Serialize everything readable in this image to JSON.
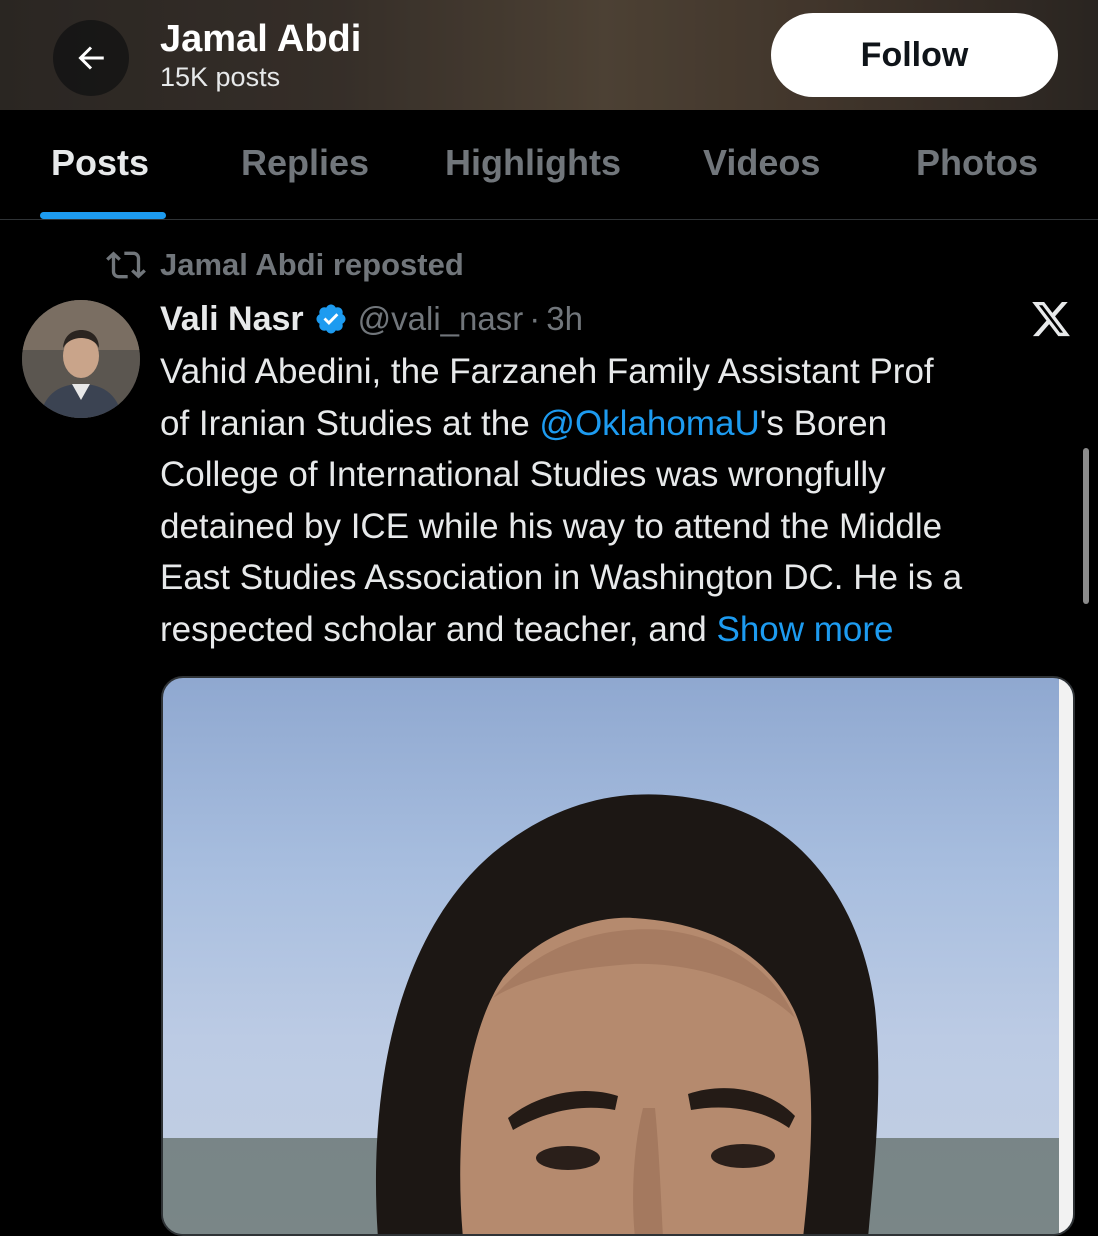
{
  "header": {
    "name": "Jamal Abdi",
    "post_count": "15K posts",
    "follow_label": "Follow"
  },
  "tabs": [
    {
      "label": "Posts",
      "active": true
    },
    {
      "label": "Replies",
      "active": false
    },
    {
      "label": "Highlights",
      "active": false
    },
    {
      "label": "Videos",
      "active": false
    },
    {
      "label": "Photos",
      "active": false
    }
  ],
  "post": {
    "repost_text": "Jamal Abdi reposted",
    "author_name": "Vali Nasr",
    "handle": "@vali_nasr",
    "separator": "·",
    "time": "3h",
    "text_lines": [
      {
        "before": "Vahid Abedini, the Farzaneh Family Assistant Prof"
      },
      {
        "before": "of Iranian Studies at the ",
        "mention": "@OklahomaU",
        "after": "'s Boren"
      },
      {
        "before": "College of International Studies was wrongfully"
      },
      {
        "before": "detained by ICE while his way to attend the Middle"
      },
      {
        "before": "East Studies Association in Washington DC. He is a"
      },
      {
        "before": "respected scholar and teacher, and ",
        "link": "Show more"
      }
    ]
  },
  "icons": {
    "back": "arrow-left-icon",
    "repost": "repost-icon",
    "verified": "verified-badge-icon",
    "x_logo": "x-logo-icon"
  },
  "colors": {
    "accent": "#1d9bf0",
    "muted": "#71767b",
    "text": "#e7e9ea",
    "background": "#000000"
  }
}
